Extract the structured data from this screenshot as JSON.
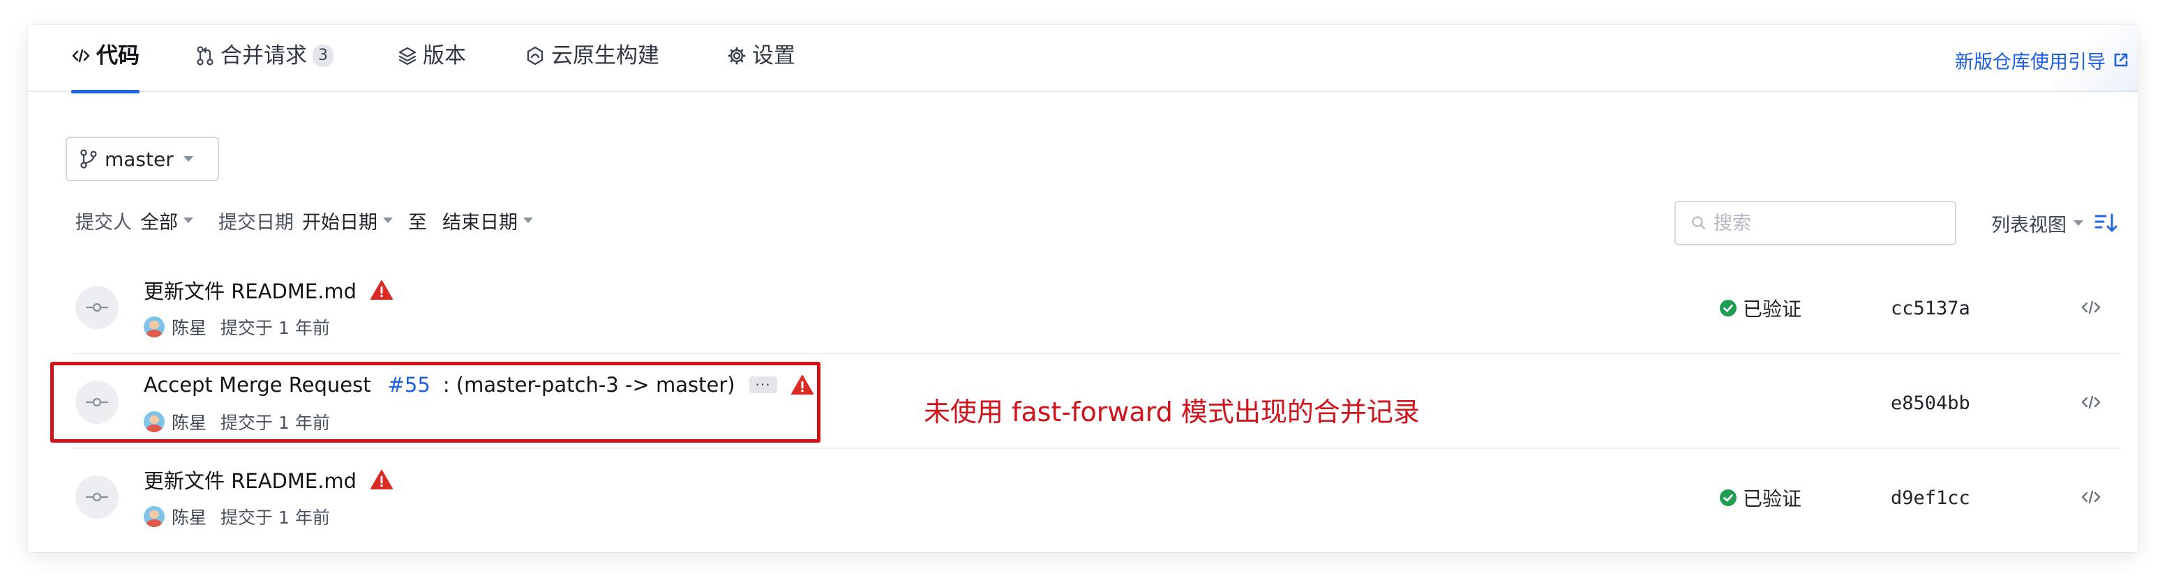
{
  "tabs": [
    {
      "label": "代码",
      "icon": "code-icon",
      "active": true
    },
    {
      "label": "合并请求",
      "icon": "merge-request-icon",
      "count": "3"
    },
    {
      "label": "版本",
      "icon": "layers-icon"
    },
    {
      "label": "云原生构建",
      "icon": "cloud-build-icon"
    },
    {
      "label": "设置",
      "icon": "gear-icon"
    }
  ],
  "guide_link": {
    "label": "新版仓库使用引导",
    "icon": "external-link-icon"
  },
  "branch": {
    "label": "master",
    "icon": "branch-icon"
  },
  "filters": {
    "committer_label": "提交人",
    "committer_value": "全部",
    "date_label": "提交日期",
    "start_date": "开始日期",
    "to": "至",
    "end_date": "结束日期"
  },
  "search": {
    "placeholder": "搜索"
  },
  "view": {
    "label": "列表视图",
    "sort_icon": "sort-desc-icon"
  },
  "commits": [
    {
      "title": "更新文件 README.md",
      "author": "陈星",
      "time": "提交于 1 年前",
      "verified": "已验证",
      "sha": "cc5137a",
      "warning": true
    },
    {
      "title": "Accept Merge Request",
      "mr_link": "#55",
      "title_rest": ": (master-patch-3 -> master)",
      "more": "···",
      "author": "陈星",
      "time": "提交于 1 年前",
      "verified": "",
      "sha": "e8504bb",
      "warning": true
    },
    {
      "title": "更新文件 README.md",
      "author": "陈星",
      "time": "提交于 1 年前",
      "verified": "已验证",
      "sha": "d9ef1cc",
      "warning": true
    }
  ],
  "annotation": "未使用 fast-forward 模式出现的合并记录",
  "colors": {
    "accent": "#2266e8",
    "link": "#1d5ee8",
    "warning": "#d92b23",
    "verified": "#1f9d55",
    "annotation": "#d0121b"
  }
}
